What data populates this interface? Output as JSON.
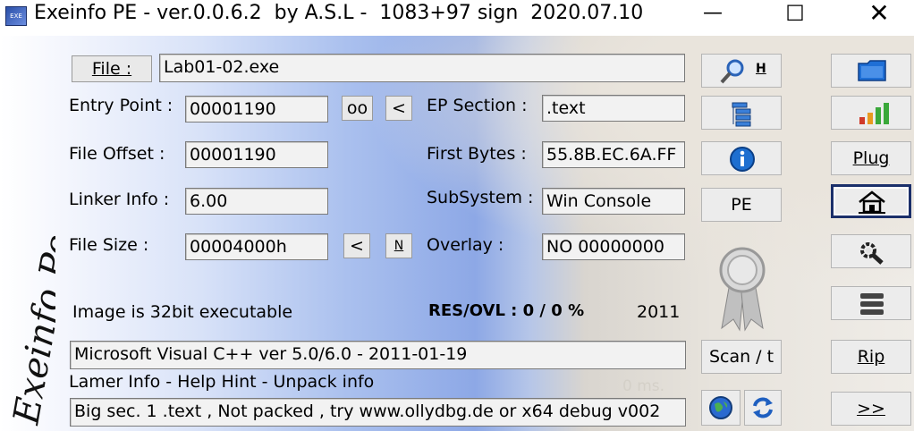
{
  "window": {
    "title": "Exeinfo PE - ver.0.0.6.2  by A.S.L -  1083+97 sign  2020.07.10",
    "icon_label": "EXE"
  },
  "side_logo_text": "Exeinfo Pe",
  "file": {
    "button_label": "File :",
    "value": "Lab01-02.exe"
  },
  "fields": {
    "entry_point": {
      "label": "Entry Point :",
      "value": "00001190"
    },
    "file_offset": {
      "label": "File Offset :",
      "value": "00001190"
    },
    "linker_info": {
      "label": "Linker Info :",
      "value": "6.00"
    },
    "file_size": {
      "label": "File Size :",
      "value": "00004000h"
    },
    "ep_section": {
      "label": "EP Section :",
      "value": ".text"
    },
    "first_bytes": {
      "label": "First Bytes :",
      "value": "55.8B.EC.6A.FF"
    },
    "subsystem": {
      "label": "SubSystem :",
      "value": "Win Console"
    },
    "overlay": {
      "label": "Overlay :",
      "value": "NO   00000000"
    }
  },
  "small_buttons": {
    "oo": "oo",
    "lt1": "<",
    "lt2": "<",
    "n": "N"
  },
  "info": {
    "image_type": "Image is 32bit executable",
    "res_ovl": "RES/OVL : 0 / 0 %",
    "year": "2011",
    "detection": "Microsoft Visual C++ ver 5.0/6.0 - 2011-01-19",
    "lamer_info": "Lamer Info - Help Hint - Unpack info",
    "hint": "Big sec. 1 .text , Not packed , try  www.ollydbg.de or x64 debug v002",
    "status": "0 ms."
  },
  "right_buttons": {
    "h_label": "H",
    "pe": "PE",
    "scan": "Scan / t",
    "plug": "Plug",
    "rip": "Rip",
    "next": ">>"
  },
  "colors": {
    "blue_icon": "#1e6fd0",
    "green_bar": "#3aa83a",
    "red_bar": "#d03a2a",
    "orange_bar": "#e89a20"
  }
}
